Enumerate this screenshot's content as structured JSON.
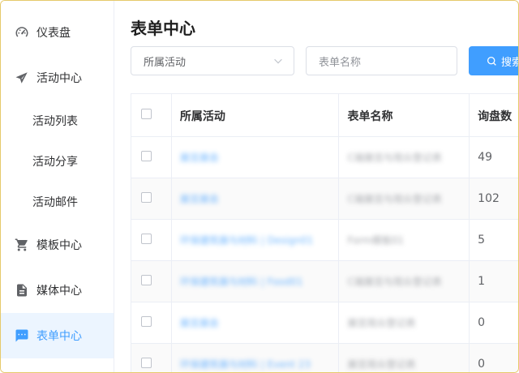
{
  "sidebar": {
    "items": [
      {
        "label": "仪表盘",
        "icon": "dashboard-icon"
      },
      {
        "label": "活动中心",
        "icon": "paper-plane-icon"
      },
      {
        "label": "活动列表"
      },
      {
        "label": "活动分享"
      },
      {
        "label": "活动邮件"
      },
      {
        "label": "模板中心",
        "icon": "cart-icon"
      },
      {
        "label": "媒体中心",
        "icon": "document-icon"
      },
      {
        "label": "表单中心",
        "icon": "chat-icon",
        "active": true
      }
    ]
  },
  "main": {
    "title": "表单中心",
    "activity_select": {
      "placeholder": "所属活动"
    },
    "form_name_input": {
      "placeholder": "表单名称"
    },
    "search_button": {
      "label": "搜索"
    }
  },
  "table": {
    "columns": [
      "所属活动",
      "表单名称",
      "询盘数"
    ],
    "rows": [
      {
        "activity": "展览展会",
        "form": "C端展览与观众登记表",
        "count": "49"
      },
      {
        "activity": "展览展会",
        "form": "C端展览与观众登记表",
        "count": "102"
      },
      {
        "activity": "环保建筑展与材料 | Design01",
        "form": "Form模板01",
        "count": "5"
      },
      {
        "activity": "环保建筑展与材料 | Food01",
        "form": "C端展览与观众登记表",
        "count": "1"
      },
      {
        "activity": "展览展会",
        "form": "展览观众登记表",
        "count": "0"
      },
      {
        "activity": "环保建筑展与材料 | Event 23",
        "form": "展览观众登记表",
        "count": "0"
      }
    ]
  },
  "colors": {
    "accent": "#409eff",
    "active_bg": "#ecf5ff",
    "border": "#ebeef5"
  }
}
